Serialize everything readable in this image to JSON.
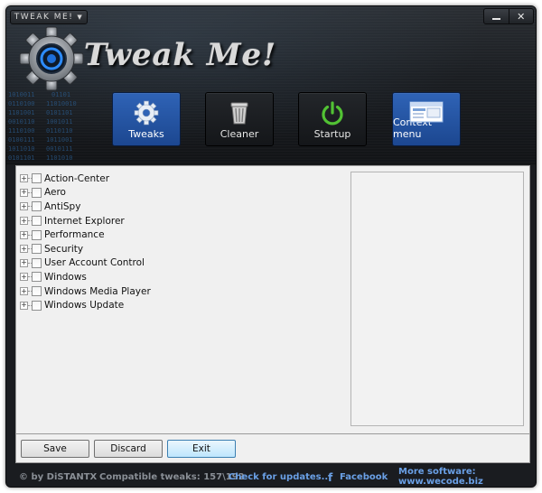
{
  "window": {
    "title_button": "TWEAK ME!",
    "minimize_icon": "minimize-icon",
    "close_icon": "close-icon",
    "close_glyph": "✕"
  },
  "header": {
    "app_title": "Tweak Me!",
    "logo_icon": "gear-logo-icon"
  },
  "nav": [
    {
      "label": "Tweaks",
      "icon": "gear-icon",
      "active": true
    },
    {
      "label": "Cleaner",
      "icon": "trash-icon",
      "active": false
    },
    {
      "label": "Startup",
      "icon": "power-icon",
      "active": false
    },
    {
      "label": "Context menu",
      "icon": "context-menu-icon",
      "active": true
    }
  ],
  "tree": {
    "items": [
      {
        "label": "Action-Center",
        "checked": false
      },
      {
        "label": "Aero",
        "checked": false
      },
      {
        "label": "AntiSpy",
        "checked": false
      },
      {
        "label": "Internet Explorer",
        "checked": false
      },
      {
        "label": "Performance",
        "checked": false
      },
      {
        "label": "Security",
        "checked": false
      },
      {
        "label": "User Account Control",
        "checked": false
      },
      {
        "label": "Windows",
        "checked": false
      },
      {
        "label": "Windows Media Player",
        "checked": false
      },
      {
        "label": "Windows Update",
        "checked": false
      }
    ],
    "expander_glyph": "+"
  },
  "buttons": {
    "save": "Save",
    "discard": "Discard",
    "exit": "Exit"
  },
  "footer": {
    "copyright": "© by DiSTANTX",
    "compatible": "Compatible tweaks: 157\\192",
    "check_updates": "Check for updates...",
    "facebook": "Facebook",
    "facebook_icon": "facebook-icon",
    "facebook_glyph": "f",
    "more_software": "More software: www.wecode.biz"
  },
  "colors": {
    "accent_blue": "#2f63b6",
    "link_blue": "#6aa0e6",
    "header_dark": "#1b1e22"
  }
}
